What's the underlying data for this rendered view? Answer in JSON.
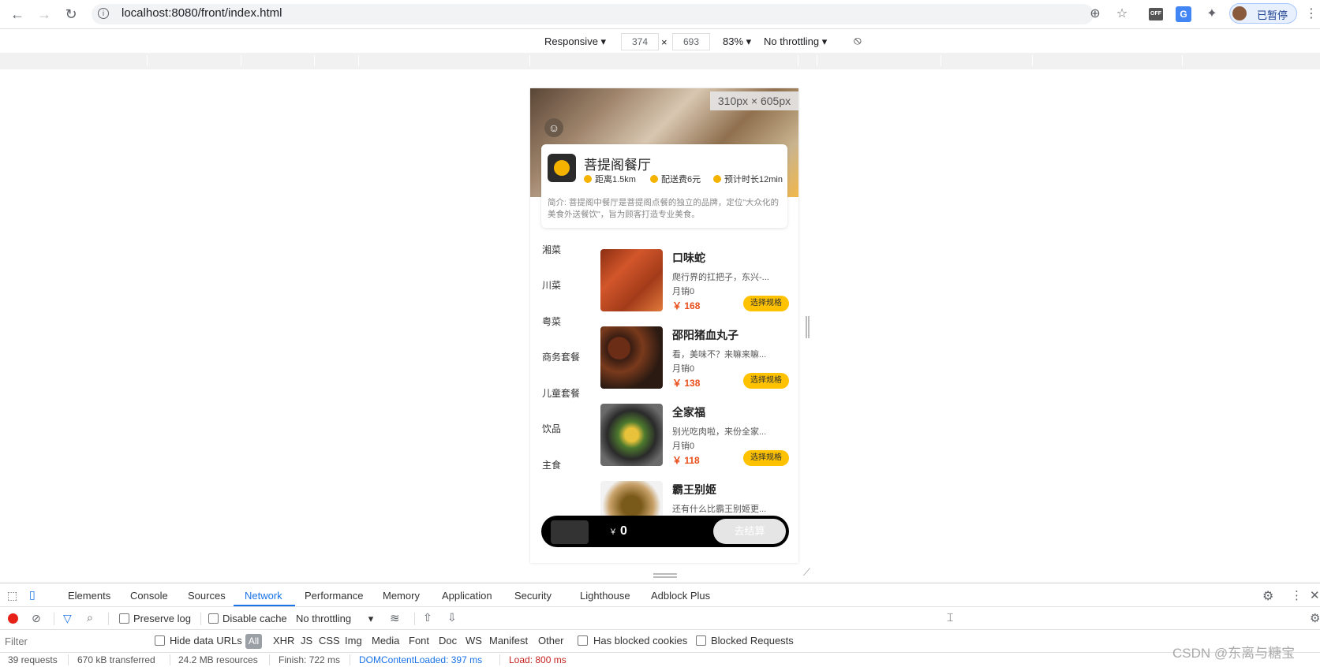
{
  "browser": {
    "url": "localhost:8080/front/index.html",
    "profile_label": "已暂停",
    "ext_off_label": "OFF"
  },
  "device_toolbar": {
    "device": "Responsive",
    "width": "374",
    "times": "×",
    "height": "693",
    "zoom": "83%",
    "throttle": "No throttling"
  },
  "app": {
    "size_tag": "310px × 605px",
    "shop_name": "菩提阁餐厅",
    "meta": [
      "距离1.5km",
      "配送费6元",
      "预计时长12min"
    ],
    "intro": "简介: 菩提阁中餐厅是菩提阁点餐的独立的品牌，定位\"大众化的美食外送餐饮\"，旨为顾客打造专业美食。",
    "categories": [
      "湘菜",
      "川菜",
      "粤菜",
      "商务套餐",
      "儿童套餐",
      "饮品",
      "主食"
    ],
    "dishes": [
      {
        "name": "口味蛇",
        "desc": "爬行界的扛把子，东兴-...",
        "sales": "月销0",
        "price": "168",
        "button": "选择规格"
      },
      {
        "name": "邵阳猪血丸子",
        "desc": "看，美味不？来嘛来嘛...",
        "sales": "月销0",
        "price": "138",
        "button": "选择规格"
      },
      {
        "name": "全家福",
        "desc": "别光吃肉啦，来份全家...",
        "sales": "月销0",
        "price": "118",
        "button": "选择规格"
      },
      {
        "name": "霸王别姬",
        "desc": "还有什么比霸王别姬更...",
        "sales": "",
        "price": "",
        "button": ""
      }
    ],
    "currency": "￥",
    "cart_total": "0",
    "checkout_label": "去结算"
  },
  "devtools": {
    "tabs": [
      "Elements",
      "Console",
      "Sources",
      "Network",
      "Performance",
      "Memory",
      "Application",
      "Security",
      "Lighthouse",
      "Adblock Plus"
    ],
    "active_tab": "Network",
    "toolbar": {
      "preserve_log": "Preserve log",
      "disable_cache": "Disable cache",
      "throttle": "No throttling"
    },
    "filter": {
      "placeholder": "Filter",
      "hide_data_urls": "Hide data URLs",
      "types": [
        "All",
        "XHR",
        "JS",
        "CSS",
        "Img",
        "Media",
        "Font",
        "Doc",
        "WS",
        "Manifest",
        "Other"
      ],
      "has_blocked_cookies": "Has blocked cookies",
      "blocked_requests": "Blocked Requests"
    },
    "status": {
      "requests": "39 requests",
      "transferred": "670 kB transferred",
      "resources": "24.2 MB resources",
      "finish": "Finish: 722 ms",
      "dcl": "DOMContentLoaded: 397 ms",
      "load": "Load: 800 ms"
    }
  },
  "watermark": "CSDN @东离与糖宝",
  "colors": {
    "accent": "#ffc200",
    "price": "#e94e1b",
    "devtools_active": "#1a73e8"
  }
}
